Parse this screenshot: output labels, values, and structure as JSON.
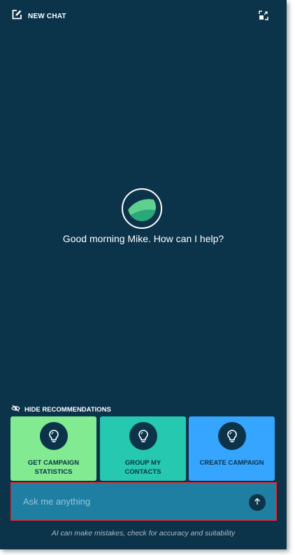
{
  "header": {
    "new_chat_label": "NEW CHAT",
    "new_chat_icon": "edit-icon",
    "expand_icon": "expand-icon"
  },
  "main": {
    "logo_icon": "leaf-logo-icon",
    "greeting": "Good morning Mike. How can I help?"
  },
  "recommendations": {
    "toggle_label": "HIDE RECOMMENDATIONS",
    "toggle_icon": "eye-off-icon",
    "cards": [
      {
        "label": "GET CAMPAIGN STATISTICS",
        "icon": "lightbulb-icon",
        "color": "#82eb91"
      },
      {
        "label": "GROUP MY CONTACTS",
        "icon": "lightbulb-icon",
        "color": "#26c9b0"
      },
      {
        "label": "CREATE CAMPAIGN",
        "icon": "lightbulb-icon",
        "color": "#35a5ff"
      }
    ]
  },
  "input": {
    "placeholder": "Ask me anything",
    "value": "",
    "send_icon": "arrow-up-icon"
  },
  "footer": {
    "disclaimer": "AI can make mistakes, check for accuracy and suitability"
  },
  "colors": {
    "panel_bg": "#0b344a",
    "input_bg": "#1f7fa3",
    "highlight_border": "#dc2e3a"
  }
}
